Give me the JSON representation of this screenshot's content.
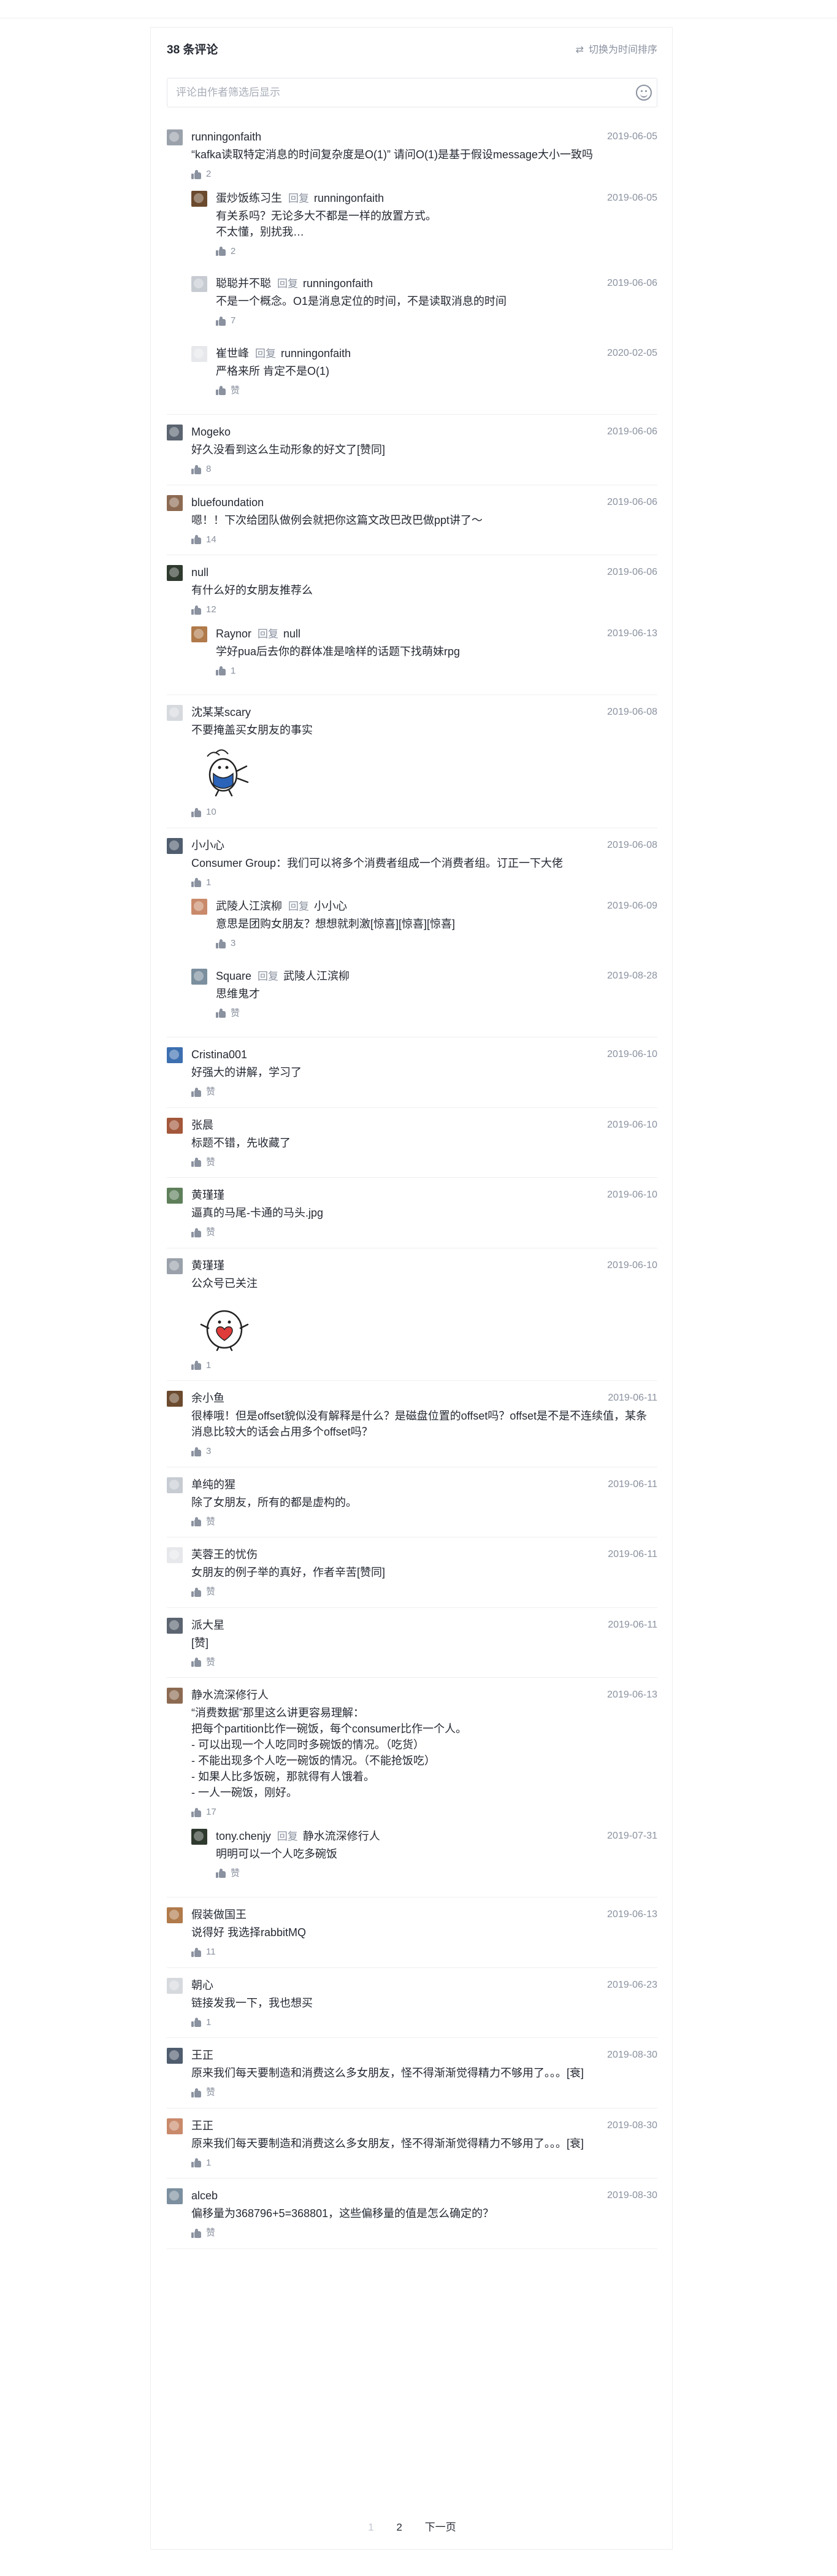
{
  "header": {
    "count_title": "38 条评论",
    "sort_toggle": "切换为时间排序",
    "filter_placeholder": "评论由作者筛选后显示"
  },
  "colors": {
    "accent": "#1e80ff",
    "text": "#252933",
    "muted": "#8a919f",
    "border": "#e4e6eb"
  },
  "icons": {
    "sort": "swap-icon",
    "emoji": "smiley-icon",
    "like": "thumbs-up-icon"
  },
  "comments": [
    {
      "user": "runningonfaith",
      "date": "2019-06-05",
      "text": "“kafka读取特定消息的时间复杂度是O(1)” 请问O(1)是基于假设message大小一致吗",
      "likes": "2",
      "replies": [
        {
          "user": "蛋炒饭练习生",
          "reply_word": "回复",
          "target": "runningonfaith",
          "date": "2019-06-05",
          "text": "有关系吗？无论多大不都是一样的放置方式。\n不太懂，别扰我…",
          "likes": "2"
        },
        {
          "user": "聪聪并不聪",
          "reply_word": "回复",
          "target": "runningonfaith",
          "date": "2019-06-06",
          "text": "不是一个概念。O1是消息定位的时间，不是读取消息的时间",
          "likes": "7"
        },
        {
          "user": "崔世峰",
          "reply_word": "回复",
          "target": "runningonfaith",
          "date": "2020-02-05",
          "text": "严格来所 肯定不是O(1)",
          "likes": "赞"
        }
      ]
    },
    {
      "user": "Mogeko",
      "date": "2019-06-06",
      "text": "好久没看到这么生动形象的好文了[赞同]",
      "likes": "8",
      "replies": []
    },
    {
      "user": "bluefoundation",
      "date": "2019-06-06",
      "text": "嗯！！下次给团队做例会就把你这篇文改巴改巴做ppt讲了～",
      "likes": "14",
      "replies": []
    },
    {
      "user": "null",
      "date": "2019-06-06",
      "text": "有什么好的女朋友推荐么",
      "likes": "12",
      "replies": [
        {
          "user": "Raynor",
          "reply_word": "回复",
          "target": "null",
          "date": "2019-06-13",
          "text": "学好pua后去你的群体准是啥样的话题下找萌妹rpg",
          "likes": "1"
        }
      ]
    },
    {
      "user": "沈某某scary",
      "date": "2019-06-08",
      "text": "不要掩盖买女朋友的事实",
      "sticker": "dancing-penguin-sticker",
      "likes": "10",
      "replies": []
    },
    {
      "user": "小小心",
      "date": "2019-06-08",
      "text": "Consumer Group：我们可以将多个消费者组成一个消费者组。订正一下大佬",
      "likes": "1",
      "replies": [
        {
          "user": "武陵人江滨柳",
          "reply_word": "回复",
          "target": "小小心",
          "date": "2019-06-09",
          "text": "意思是团购女朋友？想想就刺激[惊喜][惊喜][惊喜]",
          "likes": "3"
        },
        {
          "user": "Square",
          "reply_word": "回复",
          "target": "武陵人江滨柳",
          "date": "2019-08-28",
          "text": "思维鬼才",
          "likes": "赞"
        }
      ]
    },
    {
      "user": "Cristina001",
      "date": "2019-06-10",
      "text": "好强大的讲解，学习了",
      "likes": "赞",
      "replies": []
    },
    {
      "user": "张晨",
      "date": "2019-06-10",
      "text": "标题不错，先收藏了",
      "likes": "赞",
      "replies": []
    },
    {
      "user": "黄瑾瑾",
      "date": "2019-06-10",
      "text": "逼真的马尾-卡通的马头.jpg",
      "likes": "赞",
      "replies": []
    },
    {
      "user": "黄瑾瑾",
      "date": "2019-06-10",
      "text": "公众号已关注",
      "sticker": "heart-penguin-sticker",
      "likes": "1",
      "replies": []
    },
    {
      "user": "余小鱼",
      "date": "2019-06-11",
      "text": "很棒哦！但是offset貌似没有解释是什么？是磁盘位置的offset吗？offset是不是不连续值，某条消息比较大的话会占用多个offset吗？",
      "likes": "3",
      "replies": []
    },
    {
      "user": "单纯的猩",
      "date": "2019-06-11",
      "text": "除了女朋友，所有的都是虚构的。",
      "likes": "赞",
      "replies": []
    },
    {
      "user": "芙蓉王的忧伤",
      "date": "2019-06-11",
      "text": "女朋友的例子举的真好，作者辛苦[赞同]",
      "likes": "赞",
      "replies": []
    },
    {
      "user": "派大星",
      "date": "2019-06-11",
      "text": "[赞]",
      "likes": "赞",
      "replies": []
    },
    {
      "user": "静水流深修行人",
      "date": "2019-06-13",
      "text": "“消费数据”那里这么讲更容易理解：\n把每个partition比作一碗饭，每个consumer比作一个人。\n- 可以出现一个人吃同时多碗饭的情况。（吃货）\n- 不能出现多个人吃一碗饭的情况。（不能抢饭吃）\n- 如果人比多饭碗，那就得有人饿着。\n- 一人一碗饭，刚好。",
      "likes": "17",
      "replies": [
        {
          "user": "tony.chenjy",
          "reply_word": "回复",
          "target": "静水流深修行人",
          "date": "2019-07-31",
          "text": "明明可以一个人吃多碗饭",
          "likes": "赞"
        }
      ]
    },
    {
      "user": "假装做国王",
      "date": "2019-06-13",
      "text": "说得好 我选择rabbitMQ",
      "likes": "11",
      "replies": []
    },
    {
      "user": "朝心",
      "date": "2019-06-23",
      "text": "链接发我一下，我也想买",
      "likes": "1",
      "replies": []
    },
    {
      "user": "王正",
      "date": "2019-08-30",
      "text": "原来我们每天要制造和消费这么多女朋友，怪不得渐渐觉得精力不够用了。。。[衰]",
      "likes": "赞",
      "replies": []
    },
    {
      "user": "王正",
      "date": "2019-08-30",
      "text": "原来我们每天要制造和消费这么多女朋友，怪不得渐渐觉得精力不够用了。。。[衰]",
      "likes": "1",
      "replies": []
    },
    {
      "user": "alceb",
      "date": "2019-08-30",
      "text": "偏移量为368796+5=368801，这些偏移量的值是怎么确定的？",
      "likes": "赞",
      "replies": []
    }
  ],
  "pagination": {
    "prev": "1",
    "current": "2",
    "next": "下一页"
  }
}
